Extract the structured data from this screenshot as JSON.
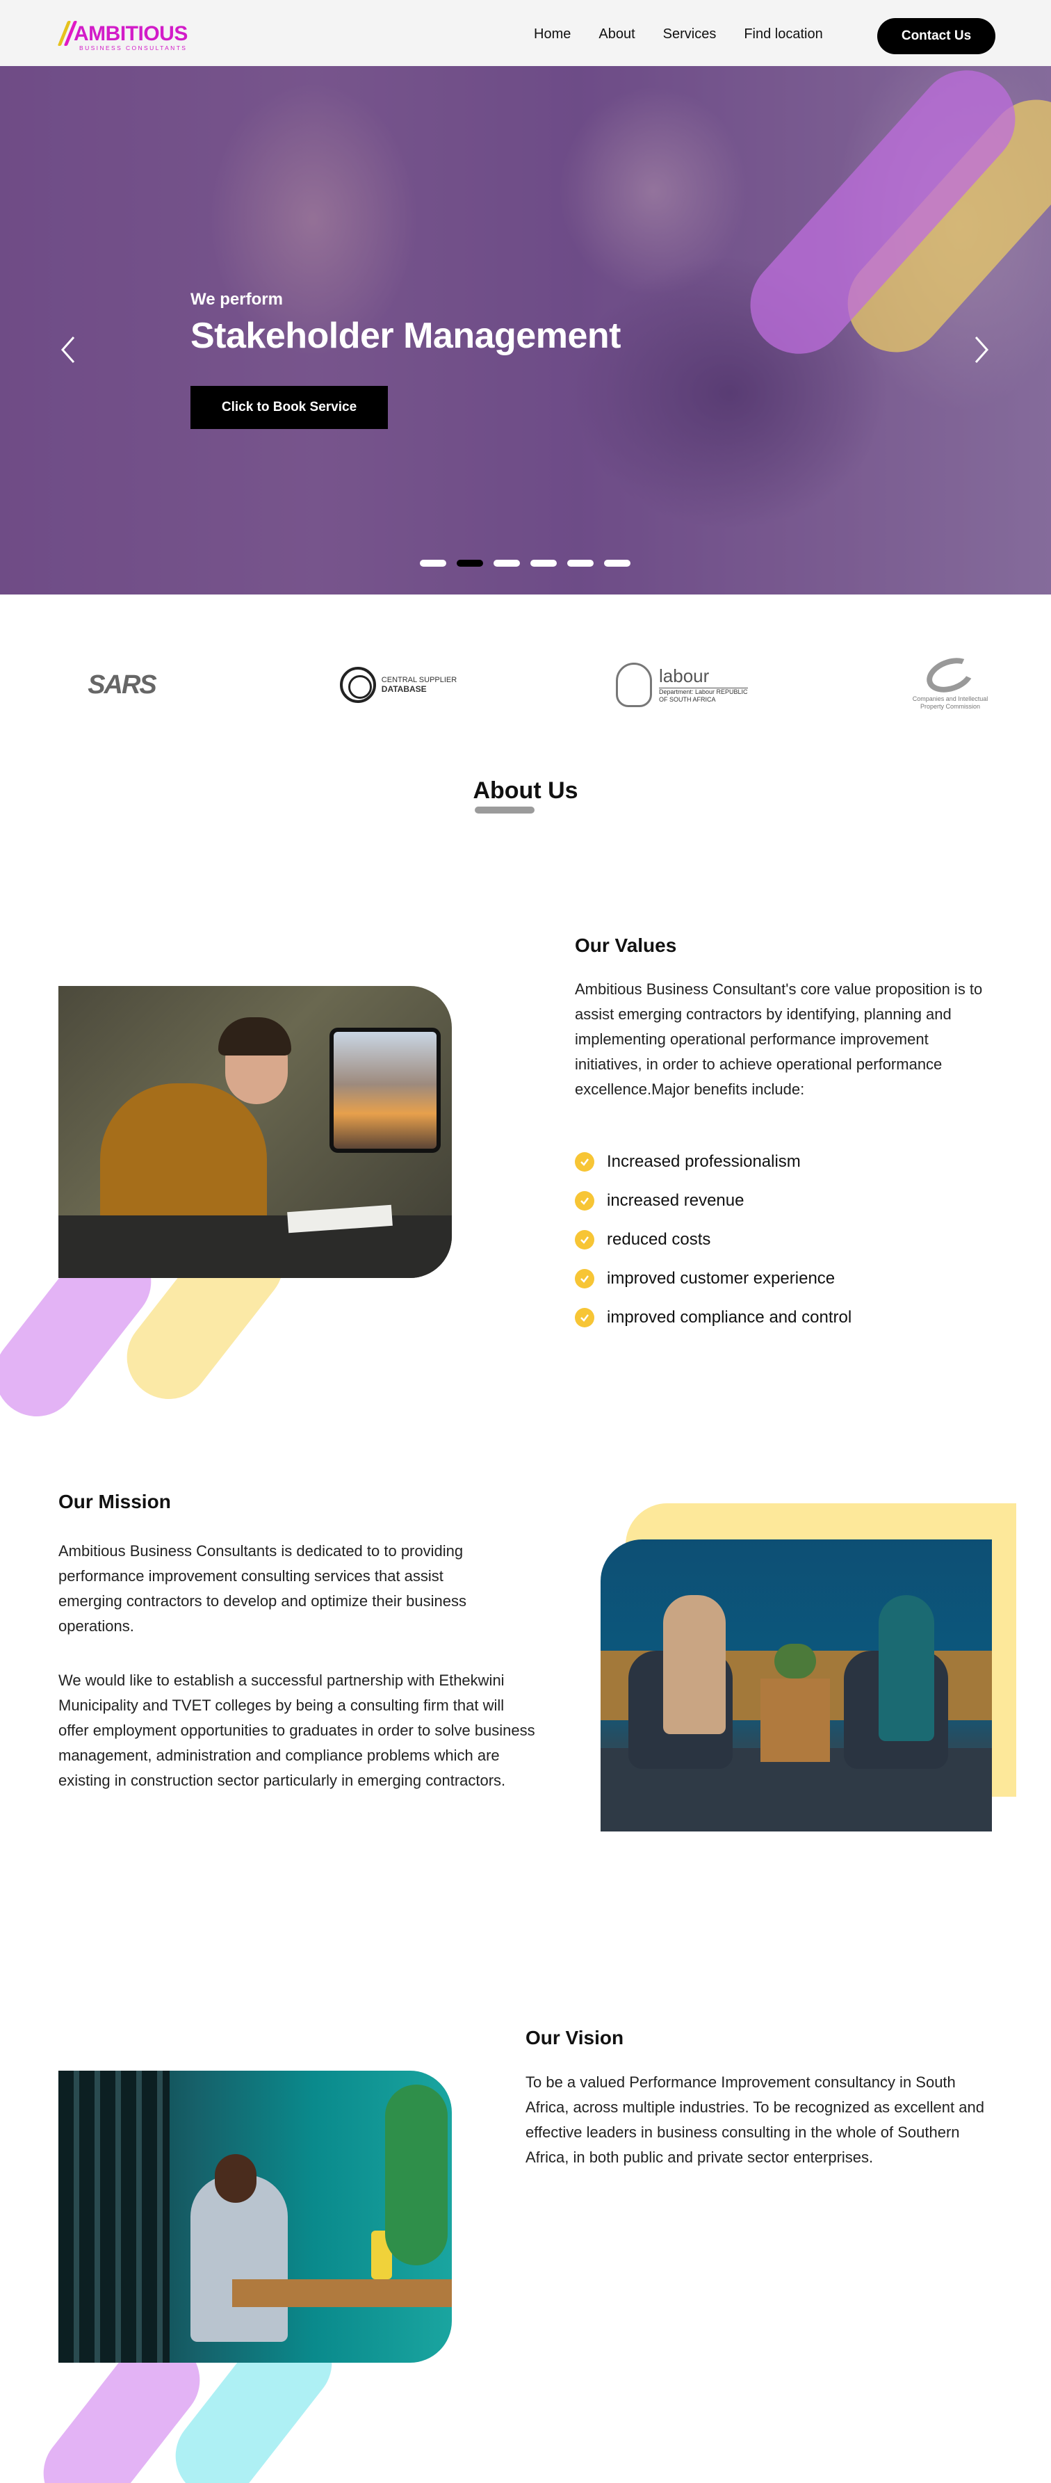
{
  "nav": {
    "logo_text": "AMBITIOUS",
    "logo_sub": "BUSINESS CONSULTANTS",
    "links": [
      "Home",
      "About",
      "Services",
      "Find location"
    ],
    "contact_label": "Contact Us"
  },
  "hero": {
    "eyebrow": "We perform",
    "title": "Stakeholder Management",
    "cta_label": "Click to Book Service",
    "slide_count": 6,
    "active_slide": 2
  },
  "partners": {
    "sars": "SARS",
    "csd_line1": "CENTRAL SUPPLIER",
    "csd_line2": "DATABASE",
    "labour_title": "labour",
    "labour_sub": "Department: Labour REPUBLIC OF SOUTH AFRICA",
    "cipc_line": "Companies and Intellectual Property Commission"
  },
  "about": {
    "heading": "About Us"
  },
  "values": {
    "title": "Our Values",
    "body": "Ambitious Business Consultant's core value proposition is to assist emerging contractors by identifying, planning and implementing operational performance improvement initiatives, in order to achieve operational performance excellence.Major benefits include:",
    "benefits": [
      "Increased professionalism",
      "increased revenue",
      "reduced costs",
      "improved customer experience",
      "improved compliance and control"
    ]
  },
  "mission": {
    "title": "Our Mission",
    "para1": "Ambitious Business Consultants is dedicated to to providing performance improvement consulting services that assist emerging contractors to develop and optimize their business operations.",
    "para2": "We would like to establish a successful partnership with Ethekwini Municipality and TVET colleges by being a consulting firm that will offer employment opportunities to graduates in order to solve business management, administration and compliance problems which are existing in construction sector particularly in emerging contractors."
  },
  "vision": {
    "title": "Our Vision",
    "body": "To be a valued Performance Improvement consultancy in South Africa, across multiple industries. To be recognized as excellent and effective leaders in business consulting in the whole of Southern Africa, in both public and private sector enterprises."
  },
  "colors": {
    "brand_magenta": "#d21cc8",
    "accent_yellow": "#f7c535",
    "accent_purple": "#d9a2f0",
    "accent_cyan": "#a8eef2"
  }
}
